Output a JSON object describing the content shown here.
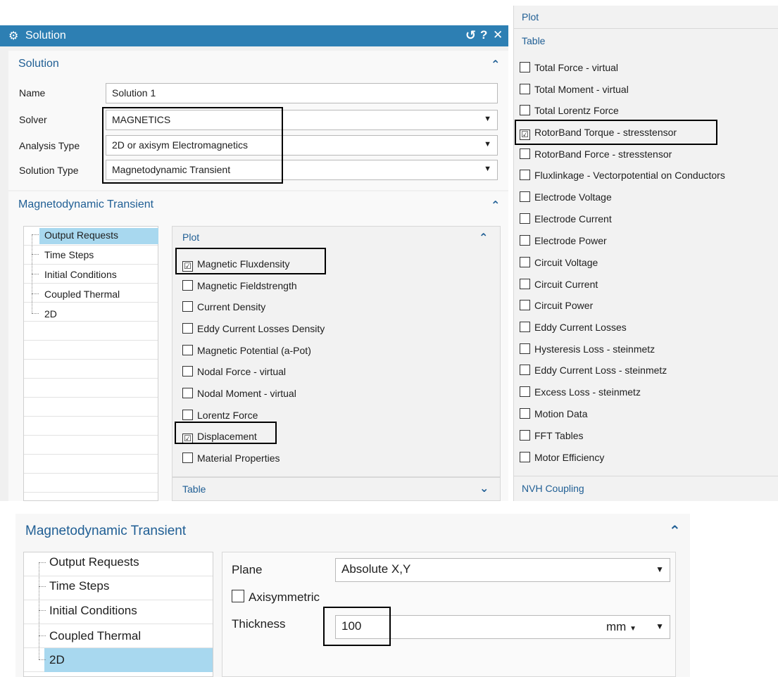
{
  "dialog": {
    "title": "Solution",
    "header_controls": {
      "reset": "↺",
      "help": "?",
      "close": "✕"
    },
    "solution_section": {
      "heading": "Solution",
      "name_label": "Name",
      "name_value": "Solution 1",
      "solver_label": "Solver",
      "solver_value": "MAGNETICS",
      "analysis_label": "Analysis Type",
      "analysis_value": "2D or axisym Electromagnetics",
      "solution_type_label": "Solution Type",
      "solution_type_value": "Magnetodynamic Transient"
    },
    "transient_section": {
      "heading": "Magnetodynamic Transient",
      "tree": [
        "Output Requests",
        "Time Steps",
        "Initial Conditions",
        "Coupled Thermal",
        "2D"
      ],
      "plot_heading": "Plot",
      "plot_items": [
        {
          "label": "Magnetic Fluxdensity",
          "checked": "☑"
        },
        {
          "label": "Magnetic Fieldstrength",
          "checked": ""
        },
        {
          "label": "Current Density",
          "checked": ""
        },
        {
          "label": "Eddy Current Losses Density",
          "checked": ""
        },
        {
          "label": "Magnetic Potential (a-Pot)",
          "checked": ""
        },
        {
          "label": "Nodal Force - virtual",
          "checked": ""
        },
        {
          "label": "Nodal Moment - virtual",
          "checked": ""
        },
        {
          "label": "Lorentz Force",
          "checked": ""
        },
        {
          "label": "Displacement",
          "checked": "☑"
        },
        {
          "label": "Material Properties",
          "checked": ""
        }
      ],
      "table_heading": "Table"
    }
  },
  "right_panel": {
    "plot_heading": "Plot",
    "table_heading": "Table",
    "items": [
      {
        "label": "Total Force - virtual",
        "checked": ""
      },
      {
        "label": "Total Moment - virtual",
        "checked": ""
      },
      {
        "label": "Total Lorentz Force",
        "checked": ""
      },
      {
        "label": "RotorBand Torque - stresstensor",
        "checked": "☑"
      },
      {
        "label": "RotorBand Force - stresstensor",
        "checked": ""
      },
      {
        "label": "Fluxlinkage - Vectorpotential on Conductors",
        "checked": ""
      },
      {
        "label": "Electrode Voltage",
        "checked": ""
      },
      {
        "label": "Electrode Current",
        "checked": ""
      },
      {
        "label": "Electrode Power",
        "checked": ""
      },
      {
        "label": "Circuit Voltage",
        "checked": ""
      },
      {
        "label": "Circuit Current",
        "checked": ""
      },
      {
        "label": "Circuit Power",
        "checked": ""
      },
      {
        "label": "Eddy Current Losses",
        "checked": ""
      },
      {
        "label": "Hysteresis Loss - steinmetz",
        "checked": ""
      },
      {
        "label": "Eddy Current Loss - steinmetz",
        "checked": ""
      },
      {
        "label": "Excess Loss - steinmetz",
        "checked": ""
      },
      {
        "label": "Motion Data",
        "checked": ""
      },
      {
        "label": "FFT Tables",
        "checked": ""
      },
      {
        "label": "Motor Efficiency",
        "checked": ""
      }
    ],
    "nvh_heading": "NVH Coupling"
  },
  "bottom_panel": {
    "heading": "Magnetodynamic Transient",
    "tree": [
      "Output Requests",
      "Time Steps",
      "Initial Conditions",
      "Coupled Thermal",
      "2D"
    ],
    "plane_label": "Plane",
    "plane_value": "Absolute X,Y",
    "axisymmetric_label": "Axisymmetric",
    "thickness_label": "Thickness",
    "thickness_value": "100",
    "thickness_unit": "mm"
  },
  "colors": {
    "accent": "#2d7fb3",
    "selected": "#a8d8ef",
    "panel_bg": "#f1f1f1",
    "link_text": "#1f5e94"
  }
}
